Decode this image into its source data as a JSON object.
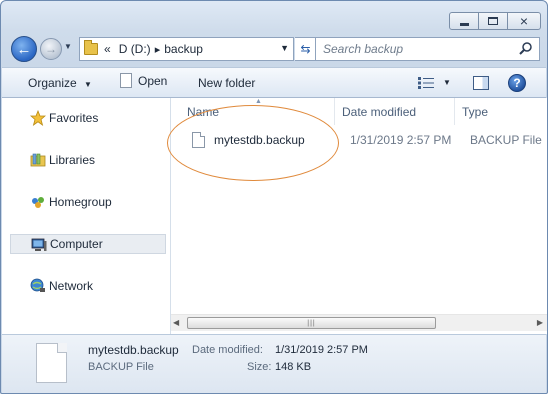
{
  "window": {
    "caption_buttons": {
      "minimize": "minimize-icon",
      "maximize": "maximize-icon",
      "close": "×"
    }
  },
  "nav": {
    "breadcrumb_prefix": "«",
    "drive": "D (D:)",
    "folder": "backup",
    "search_placeholder": "Search backup"
  },
  "toolbar": {
    "organize": "Organize",
    "open": "Open",
    "new_folder": "New folder"
  },
  "sidebar": {
    "items": [
      {
        "label": "Favorites",
        "icon": "star-icon"
      },
      {
        "label": "Libraries",
        "icon": "libraries-icon"
      },
      {
        "label": "Homegroup",
        "icon": "homegroup-icon"
      },
      {
        "label": "Computer",
        "icon": "computer-icon"
      },
      {
        "label": "Network",
        "icon": "network-icon"
      }
    ]
  },
  "list": {
    "columns": [
      "Name",
      "Date modified",
      "Type"
    ],
    "files": [
      {
        "name": "mytestdb.backup",
        "date_modified": "1/31/2019 2:57 PM",
        "type": "BACKUP File"
      }
    ]
  },
  "details": {
    "name": "mytestdb.backup",
    "type": "BACKUP File",
    "date_modified_label": "Date modified:",
    "date_modified": "1/31/2019 2:57 PM",
    "size_label": "Size:",
    "size": "148 KB"
  },
  "colors": {
    "highlight": "#e08a3c",
    "accent": "#2a66c4"
  }
}
